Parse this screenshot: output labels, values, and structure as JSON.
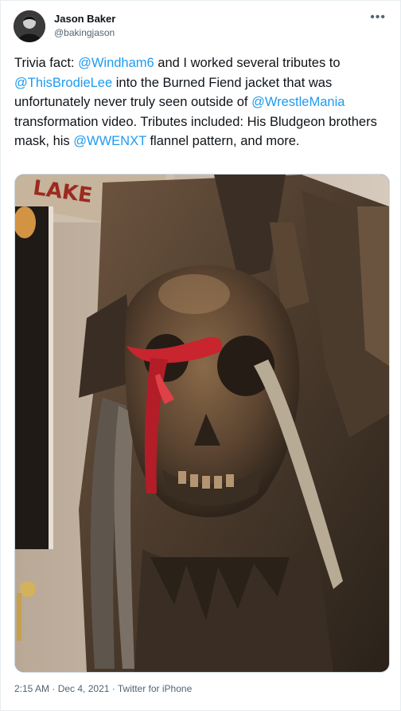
{
  "author": {
    "name": "Jason Baker",
    "handle": "@bakingjason"
  },
  "menu_icon": "more-horizontal-icon",
  "tweet": {
    "segments": [
      {
        "text": "Trivia fact: ",
        "type": "text"
      },
      {
        "text": "@Windham6",
        "type": "mention"
      },
      {
        "text": " and I worked several tributes to ",
        "type": "text"
      },
      {
        "text": "@ThisBrodieLee",
        "type": "mention"
      },
      {
        "text": " into the Burned Fiend jacket that was unfortunately never truly seen outside of ",
        "type": "text"
      },
      {
        "text": "@WrestleMania",
        "type": "mention"
      },
      {
        "text": " transformation video. Tributes included: His Bludgeon brothers mask, his ",
        "type": "text"
      },
      {
        "text": "@WWENXT",
        "type": "mention"
      },
      {
        "text": " flannel pattern, and more.",
        "type": "text"
      }
    ]
  },
  "media": {
    "wall_sign_text": "LAKE"
  },
  "meta": {
    "time": "2:15 AM",
    "separator1": " · ",
    "date": "Dec 4, 2021",
    "separator2": " · ",
    "source": "Twitter for iPhone"
  },
  "colors": {
    "link": "#1d9bf0",
    "text": "#0f1419",
    "secondary": "#536471",
    "border": "#cfd9de"
  }
}
